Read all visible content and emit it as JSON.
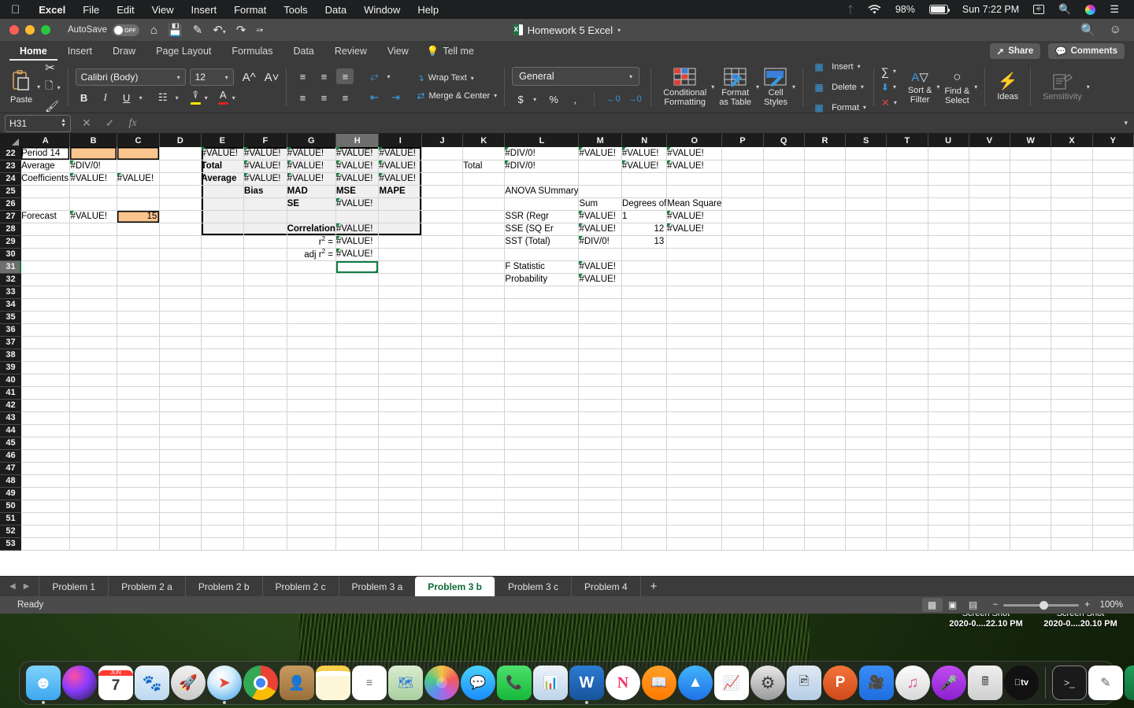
{
  "menubar": {
    "apple": "apple-logo",
    "items": [
      "Excel",
      "File",
      "Edit",
      "View",
      "Insert",
      "Format",
      "Tools",
      "Data",
      "Window",
      "Help"
    ],
    "battery_pct": "98%",
    "clock": "Sun 7:22 PM"
  },
  "window": {
    "autosave_label": "AutoSave",
    "autosave_state": "OFF",
    "doc_title": "Homework 5 Excel"
  },
  "ribbon": {
    "tabs": [
      "Home",
      "Insert",
      "Draw",
      "Page Layout",
      "Formulas",
      "Data",
      "Review",
      "View"
    ],
    "active_tab": "Home",
    "tell_me": "Tell me",
    "share": "Share",
    "comments": "Comments",
    "clipboard": {
      "paste": "Paste"
    },
    "font": {
      "name": "Calibri (Body)",
      "size": "12",
      "bold": "B",
      "italic": "I",
      "underline": "U",
      "highlight_color": "#ffe600",
      "font_color": "#e02020"
    },
    "alignment": {
      "wrap_text": "Wrap Text",
      "merge_center": "Merge & Center"
    },
    "number": {
      "format": "General",
      "currency": "$",
      "percent": "%",
      "comma": ","
    },
    "styles": {
      "conditional_l1": "Conditional",
      "conditional_l2": "Formatting",
      "format_table_l1": "Format",
      "format_table_l2": "as Table",
      "cell_styles_l1": "Cell",
      "cell_styles_l2": "Styles"
    },
    "cells": {
      "insert": "Insert",
      "delete": "Delete",
      "format": "Format"
    },
    "editing": {
      "sort_l1": "Sort &",
      "sort_l2": "Filter",
      "find_l1": "Find &",
      "find_l2": "Select"
    },
    "ideas": "Ideas",
    "sensitivity": "Sensitivity"
  },
  "formula_bar": {
    "name_box": "H31",
    "formula": "",
    "fx": "fx"
  },
  "grid": {
    "columns": [
      "A",
      "B",
      "C",
      "D",
      "E",
      "F",
      "G",
      "H",
      "I",
      "J",
      "K",
      "L",
      "M",
      "N",
      "O",
      "P",
      "Q",
      "R",
      "S",
      "T",
      "U",
      "V",
      "W",
      "X",
      "Y"
    ],
    "selected_cell": "H31",
    "selected_column": "H",
    "selected_row": "31",
    "rows": [
      {
        "n": "22",
        "cells": {
          "A": "Period 14",
          "E": "#VALUE!",
          "F": "#VALUE!",
          "G": "#VALUE!",
          "H": "#VALUE!",
          "I": "#VALUE!",
          "L": "#DIV/0!",
          "M": "#VALUE!",
          "N": "#VALUE!",
          "O": "#VALUE!"
        }
      },
      {
        "n": "23",
        "cells": {
          "A": "Average",
          "B": "#DIV/0!",
          "E": "Total",
          "F": "#VALUE!",
          "G": "#VALUE!",
          "H": "#VALUE!",
          "I": "#VALUE!",
          "K": "Total",
          "L": "#DIV/0!",
          "N": "#VALUE!",
          "O": "#VALUE!"
        }
      },
      {
        "n": "24",
        "cells": {
          "A": "Coefficients",
          "B": "#VALUE!",
          "C": "#VALUE!",
          "E": "Average",
          "F": "#VALUE!",
          "G": "#VALUE!",
          "H": "#VALUE!",
          "I": "#VALUE!"
        }
      },
      {
        "n": "25",
        "cells": {
          "F": "Bias",
          "G": "MAD",
          "H": "MSE",
          "I": "MAPE",
          "L": "ANOVA SUmmary"
        }
      },
      {
        "n": "26",
        "cells": {
          "G": "SE",
          "H": "#VALUE!",
          "M": "Sum",
          "N": "Degrees of",
          "O": "Mean Square"
        }
      },
      {
        "n": "27",
        "cells": {
          "A": "Forecast",
          "B": "#VALUE!",
          "C": "15",
          "L": "SSR (Regr",
          "M": "#VALUE!",
          "N": "1",
          "O": "#VALUE!"
        }
      },
      {
        "n": "28",
        "cells": {
          "G": "Correlation",
          "H": "#VALUE!",
          "L": "SSE (SQ Er",
          "M": "#VALUE!",
          "N": "12",
          "O": "#VALUE!"
        }
      },
      {
        "n": "29",
        "cells": {
          "G": "r² =",
          "H": "#VALUE!",
          "L": "SST (Total)",
          "M": "#DIV/0!",
          "N": "13"
        }
      },
      {
        "n": "30",
        "cells": {
          "G": "adj r² =",
          "H": "#VALUE!"
        }
      },
      {
        "n": "31",
        "cells": {
          "L": "F Statistic",
          "M": "#VALUE!"
        }
      },
      {
        "n": "32",
        "cells": {
          "L": "Probability",
          "M": "#VALUE!"
        }
      },
      {
        "n": "33",
        "cells": {}
      },
      {
        "n": "34",
        "cells": {}
      },
      {
        "n": "35",
        "cells": {}
      },
      {
        "n": "36",
        "cells": {}
      },
      {
        "n": "37",
        "cells": {}
      },
      {
        "n": "38",
        "cells": {}
      },
      {
        "n": "39",
        "cells": {}
      },
      {
        "n": "40",
        "cells": {}
      },
      {
        "n": "41",
        "cells": {}
      },
      {
        "n": "42",
        "cells": {}
      },
      {
        "n": "43",
        "cells": {}
      },
      {
        "n": "44",
        "cells": {}
      },
      {
        "n": "45",
        "cells": {}
      },
      {
        "n": "46",
        "cells": {}
      },
      {
        "n": "47",
        "cells": {}
      },
      {
        "n": "48",
        "cells": {}
      },
      {
        "n": "49",
        "cells": {}
      },
      {
        "n": "50",
        "cells": {}
      },
      {
        "n": "51",
        "cells": {}
      },
      {
        "n": "52",
        "cells": {}
      },
      {
        "n": "53",
        "cells": {}
      }
    ]
  },
  "sheet_tabs": {
    "items": [
      "Problem 1",
      "Problem 2 a",
      "Problem 2 b",
      "Problem 2 c",
      "Problem 3 a",
      "Problem 3 b",
      "Problem 3 c",
      "Problem 4"
    ],
    "active": "Problem 3 b",
    "add_label": "+"
  },
  "status_bar": {
    "state": "Ready",
    "zoom": "100%"
  },
  "desktop_icons": [
    {
      "line1": "Screen Shot",
      "line2": "2020-0....22.10 PM"
    },
    {
      "line1": "Screen Shot",
      "line2": "2020-0....20.10 PM"
    }
  ],
  "dock": {
    "left": [
      "finder-icon",
      "siri-icon",
      "calendar-icon",
      "mail-icon",
      "launchpad-icon",
      "safari-icon",
      "chrome-icon",
      "contacts-icon",
      "notes-icon",
      "reminders-icon",
      "maps-icon",
      "photos-icon",
      "messages-icon",
      "facetime-icon",
      "keynote-icon",
      "word-icon",
      "news-icon",
      "books-icon",
      "app-store-icon",
      "numbers-icon",
      "system-preferences-icon",
      "preview-icon",
      "powerpoint-icon",
      "zoom-icon",
      "itunes-icon",
      "podcasts-icon",
      "calculator-icon",
      "apple-tv-icon"
    ],
    "right": [
      "terminal-icon",
      "textedit-icon",
      "excel-icon"
    ],
    "far_right": [
      "help-icon",
      "documents-stack-icon",
      "trash-icon"
    ],
    "calendar_month": "JUN",
    "calendar_day": "7"
  },
  "colors": {
    "excel_green": "#107c41",
    "accent_blue": "#2b7cd3",
    "orange_fill": "#fbc58e",
    "error_red": "#e02020"
  }
}
